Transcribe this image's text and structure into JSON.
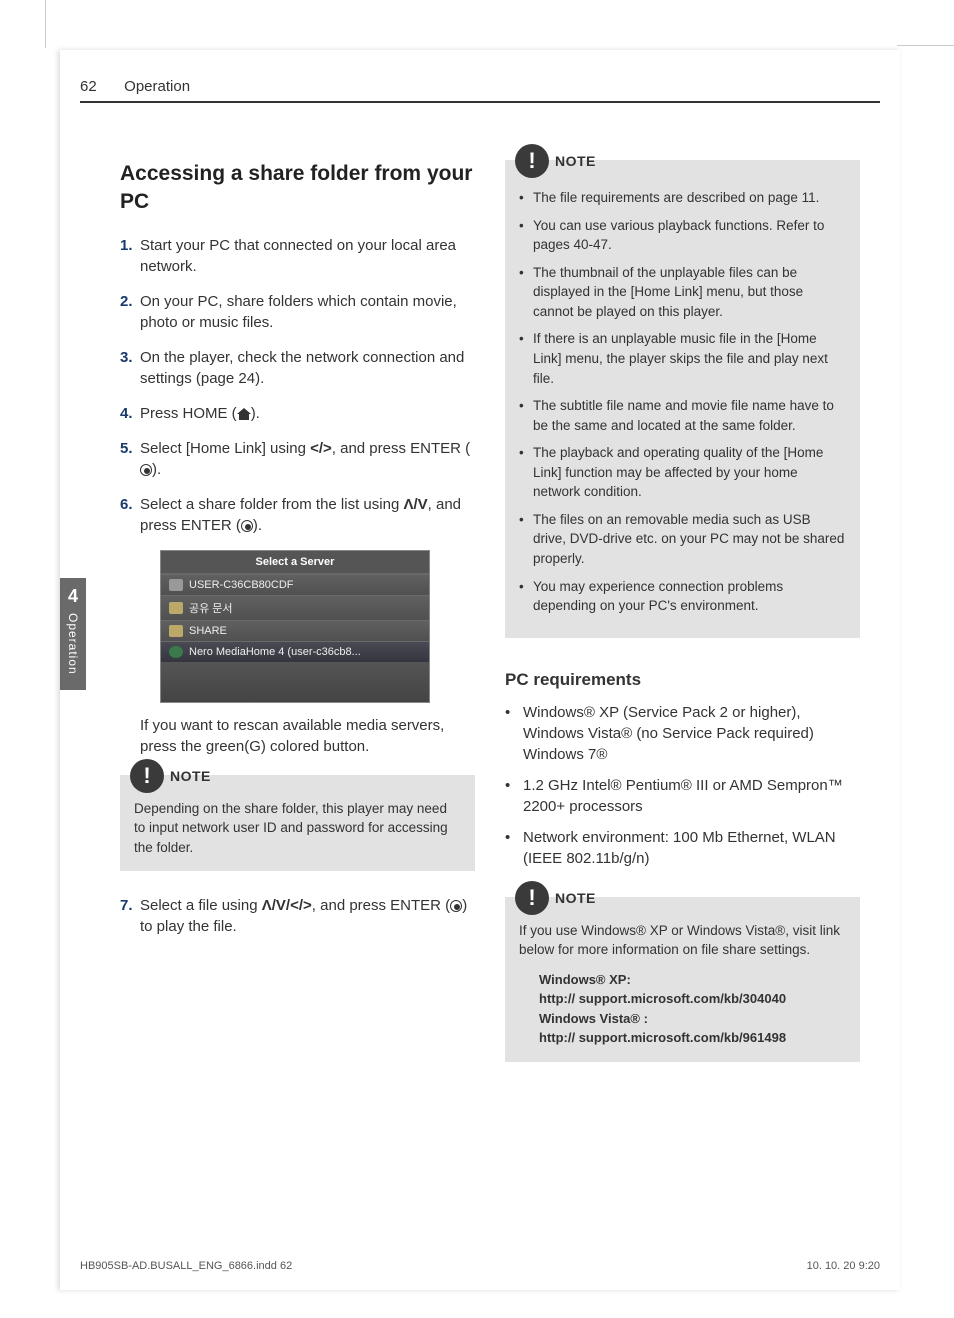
{
  "header": {
    "pagenum": "62",
    "section": "Operation"
  },
  "sideTab": {
    "chapter": "4",
    "label": "Operation"
  },
  "leftCol": {
    "title": "Accessing a share folder from your PC",
    "steps": {
      "s1": {
        "n": "1.",
        "t": "Start your PC that connected on your local area network."
      },
      "s2": {
        "n": "2.",
        "t": "On your PC, share folders which contain movie, photo or music files."
      },
      "s3": {
        "n": "3.",
        "t": "On the player, check the network connection and settings (page 24)."
      },
      "s4": {
        "n": "4.",
        "pre": "Press HOME (",
        "post": ")."
      },
      "s5": {
        "n": "5.",
        "pre": "Select [Home Link] using ",
        "mid": ", and press ENTER (",
        "post": ")."
      },
      "s6": {
        "n": "6.",
        "pre": "Select a share folder from the list using ",
        "mid": ", and press ENTER (",
        "post": ")."
      },
      "s7": {
        "n": "7.",
        "pre": "Select a file using ",
        "mid": ", and press ENTER (",
        "post": ") to play the file."
      }
    },
    "screenshot": {
      "title": "Select a Server",
      "row1": "USER-C36CB80CDF",
      "row2": "공유 문서",
      "row3": "SHARE",
      "row4": "Nero MediaHome 4 (user-c36cb8..."
    },
    "afterScreenshot": "If you want to rescan available media servers, press the green(G) colored button.",
    "note1": {
      "label": "NOTE",
      "text": "Depending on the share folder, this player may need to input network user ID and password for accessing the folder."
    }
  },
  "rightCol": {
    "note2": {
      "label": "NOTE",
      "items": {
        "i1": "The file requirements are described on page 11.",
        "i2": "You can use various playback functions. Refer to pages 40-47.",
        "i3": "The thumbnail of the unplayable files can be displayed in the [Home Link] menu, but those cannot be played on this player.",
        "i4": "If there is an unplayable music file in the [Home Link] menu, the player skips the file and play next file.",
        "i5": "The subtitle file name and movie file name have to be the same and located at the same folder.",
        "i6": "The playback and operating quality of the [Home Link] function may be affected by your home network condition.",
        "i7": "The files on an removable media such as USB drive, DVD-drive etc. on your PC may not be shared properly.",
        "i8": "You may experience connection problems depending on your PC's environment."
      }
    },
    "reqTitle": "PC requirements",
    "req": {
      "r1": "Windows® XP (Service Pack 2 or higher), Windows Vista® (no Service Pack required) Windows 7®",
      "r2": "1.2 GHz Intel® Pentium® III or AMD Sempron™ 2200+ processors",
      "r3": "Network environment: 100 Mb Ethernet, WLAN (IEEE 802.11b/g/n)"
    },
    "note3": {
      "label": "NOTE",
      "text": "If you use Windows® XP or Windows Vista®, visit link below for more information on file share settings.",
      "links": {
        "l1a": "Windows® XP:",
        "l1b": "http:// support.microsoft.com/kb/304040",
        "l2a": "Windows Vista® :",
        "l2b": "http:// support.microsoft.com/kb/961498"
      }
    }
  },
  "footer": {
    "left": "HB905SB-AD.BUSALL_ENG_6866.indd   62",
    "right": "10. 10. 20     9:20"
  },
  "arrows": {
    "lr": "</>",
    "ud": "Λ/V",
    "all": "Λ/V/</>"
  }
}
